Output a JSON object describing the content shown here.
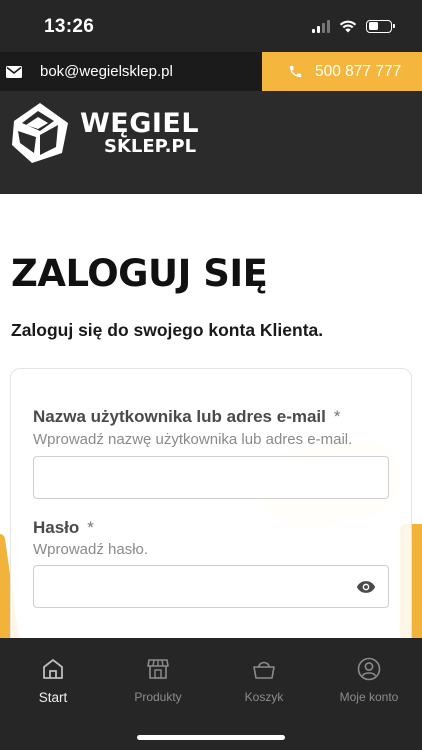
{
  "status_bar": {
    "time": "13:26",
    "icons": [
      "cellular-signal-icon",
      "wifi-icon",
      "battery-icon"
    ]
  },
  "contact": {
    "email": "bok@wegielsklep.pl",
    "phone": "500 877 777",
    "email_icon": "envelope-icon",
    "phone_icon": "phone-icon",
    "accent": "#f4b63c"
  },
  "brand": {
    "line1": "WĘGIEL",
    "line2": "SKLEP.PL",
    "icon": "coal-logo-icon"
  },
  "login": {
    "title": "ZALOGUJ SIĘ",
    "subtitle": "Zaloguj się do swojego konta Klienta.",
    "username": {
      "label": "Nazwa użytkownika lub adres e-mail",
      "required": "*",
      "hint": "Wprowadź nazwę użytkownika lub adres e-mail.",
      "value": ""
    },
    "password": {
      "label": "Hasło",
      "required": "*",
      "hint": "Wprowadź hasło.",
      "value": "",
      "toggle_icon": "eye-icon"
    }
  },
  "tabs": [
    {
      "label": "Start",
      "icon": "home-icon",
      "active": true
    },
    {
      "label": "Produkty",
      "icon": "store-icon",
      "active": false
    },
    {
      "label": "Koszyk",
      "icon": "basket-icon",
      "active": false
    },
    {
      "label": "Moje konto",
      "icon": "user-icon",
      "active": false
    }
  ],
  "colors": {
    "dark": "#262626",
    "accent": "#f4b63c",
    "text": "#111111"
  }
}
